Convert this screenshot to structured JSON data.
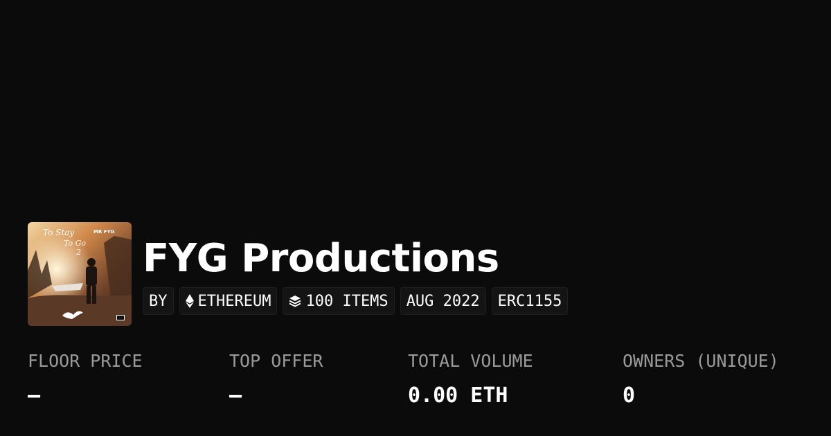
{
  "collection": {
    "title": "FYG Productions",
    "artwork": {
      "artist_text": "MR FYG",
      "album_line1": "To Stay",
      "album_line2": "To Go",
      "album_number": "2"
    }
  },
  "chips": [
    {
      "label": "BY",
      "icon": ""
    },
    {
      "label": "ETHEREUM",
      "icon": "ethereum-icon"
    },
    {
      "label": "100 ITEMS",
      "icon": "layers-icon"
    },
    {
      "label": "AUG 2022",
      "icon": ""
    },
    {
      "label": "ERC1155",
      "icon": ""
    }
  ],
  "stats": [
    {
      "label": "FLOOR PRICE",
      "value": "–"
    },
    {
      "label": "TOP OFFER",
      "value": "–"
    },
    {
      "label": "TOTAL VOLUME",
      "value": "0.00 ETH"
    },
    {
      "label": "OWNERS (UNIQUE)",
      "value": "0"
    }
  ],
  "colors": {
    "background": "#0b0b0b",
    "chip_background": "#141414",
    "label_gray": "#9a9a9a",
    "text_white": "#ffffff"
  }
}
